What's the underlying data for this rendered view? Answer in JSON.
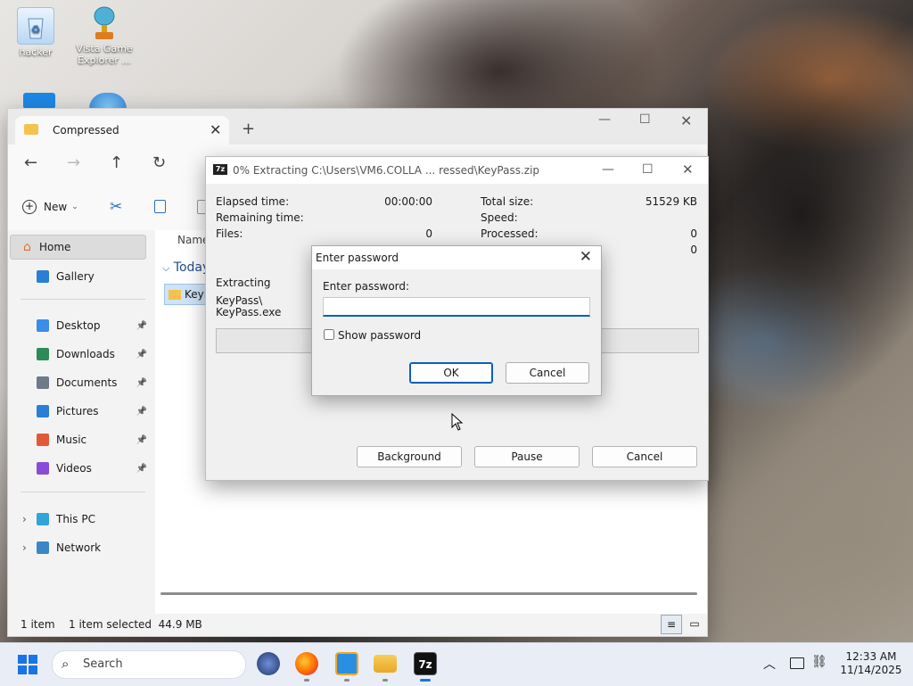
{
  "desktop": {
    "icons": [
      {
        "label": "hacker",
        "icon": "recycle-bin-icon"
      },
      {
        "label": "Vista Game Explorer ...",
        "icon": "trophy-icon"
      }
    ]
  },
  "explorer": {
    "tab_title": "Compressed",
    "toolbar": {
      "new_label": "New"
    },
    "sidebar": {
      "home": "Home",
      "gallery": "Gallery",
      "pinned": [
        {
          "label": "Desktop",
          "icon": "desktop-icon",
          "color": "#3a8ee6"
        },
        {
          "label": "Downloads",
          "icon": "download-icon",
          "color": "#2e8b57"
        },
        {
          "label": "Documents",
          "icon": "documents-icon",
          "color": "#6c7a89"
        },
        {
          "label": "Pictures",
          "icon": "pictures-icon",
          "color": "#2a7fd4"
        },
        {
          "label": "Music",
          "icon": "music-icon",
          "color": "#e05a3a"
        },
        {
          "label": "Videos",
          "icon": "videos-icon",
          "color": "#8a4bd6"
        }
      ],
      "this_pc": "This PC",
      "network": "Network"
    },
    "content": {
      "column_name": "Name",
      "group": "Today",
      "file_name": "KeyP"
    },
    "status": {
      "count": "1 item",
      "selected": "1 item selected  44.9 MB"
    }
  },
  "sevenzip": {
    "title": "0% Extracting C:\\Users\\VM6.COLLA ... ressed\\KeyPass.zip",
    "stats": {
      "elapsed_label": "Elapsed time:",
      "elapsed_value": "00:00:00",
      "remaining_label": "Remaining time:",
      "files_label": "Files:",
      "files_value": "0",
      "total_label": "Total size:",
      "total_value": "51529 KB",
      "speed_label": "Speed:",
      "processed_label": "Processed:",
      "processed_value": "0",
      "extra_value": "0"
    },
    "extracting_label": "Extracting",
    "extracting_path1": "KeyPass\\",
    "extracting_path2": "KeyPass.exe",
    "progress_percent": 0,
    "buttons": {
      "background": "Background",
      "pause": "Pause",
      "cancel": "Cancel"
    }
  },
  "password_dialog": {
    "title": "Enter password",
    "field_label": "Enter password:",
    "value": "",
    "show_password_label": "Show password",
    "show_password_checked": false,
    "ok": "OK",
    "cancel": "Cancel"
  },
  "taskbar": {
    "search_placeholder": "Search",
    "apps": [
      "globe-icon",
      "firefox-icon",
      "tool-icon",
      "file-explorer-icon",
      "7zip-icon"
    ],
    "time": "12:33 AM",
    "date": "11/14/2025"
  }
}
